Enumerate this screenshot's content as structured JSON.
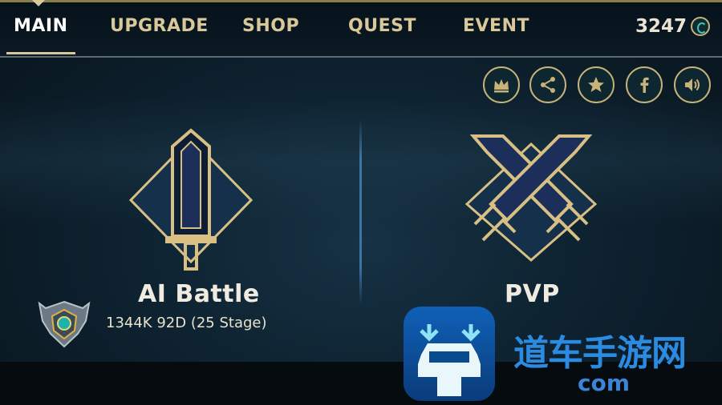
{
  "nav": {
    "tabs": [
      {
        "label": "MAIN",
        "active": true
      },
      {
        "label": "UPGRADE",
        "active": false
      },
      {
        "label": "SHOP",
        "active": false
      },
      {
        "label": "QUEST",
        "active": false
      },
      {
        "label": "EVENT",
        "active": false
      }
    ],
    "currency": "3247",
    "currency_icon": "coin-icon"
  },
  "social_icons": [
    "crown-icon",
    "share-icon",
    "star-icon",
    "facebook-icon",
    "sound-icon"
  ],
  "modes": {
    "ai_battle": {
      "label": "AI Battle",
      "icon": "sword-icon",
      "rank_text": "1344K 92D (25 Stage)",
      "rank_icon": "rank-emblem-icon"
    },
    "pvp": {
      "label": "PVP",
      "icon": "crossed-swords-icon"
    }
  },
  "watermark": {
    "text": "道车手游网",
    "url": "com"
  },
  "colors": {
    "gold": "#c7b27a",
    "navy": "#17284a",
    "background": "#0b1a24"
  }
}
